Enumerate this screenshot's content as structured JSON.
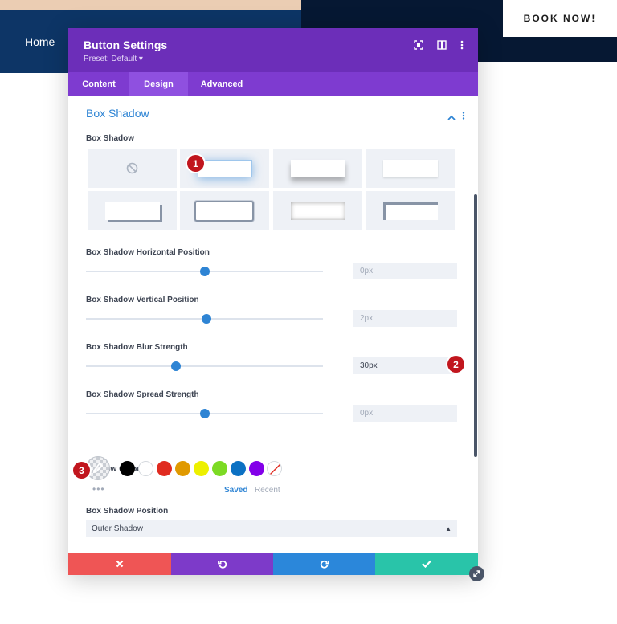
{
  "background": {
    "nav_home": "Home",
    "book_button": "BOOK NOW!"
  },
  "modal": {
    "title": "Button Settings",
    "preset": "Preset: Default ▾",
    "header_icons": [
      "expand-icon",
      "sidebar-layout-icon",
      "kebab-menu-icon"
    ],
    "tabs": [
      {
        "label": "Content",
        "active": false
      },
      {
        "label": "Design",
        "active": true
      },
      {
        "label": "Advanced",
        "active": false
      }
    ]
  },
  "section": {
    "title": "Box Shadow",
    "presets_label": "Box Shadow",
    "preset_count": 8,
    "selected_preset": 2,
    "fields": [
      {
        "label": "Box Shadow Horizontal Position",
        "value": "0px",
        "slider_fraction": 0.5
      },
      {
        "label": "Box Shadow Vertical Position",
        "value": "2px",
        "slider_fraction": 0.51
      },
      {
        "label": "Box Shadow Blur Strength",
        "value": "30px",
        "slider_fraction": 0.38
      },
      {
        "label": "Box Shadow Spread Strength",
        "value": "0px",
        "slider_fraction": 0.5
      }
    ],
    "shadow_color": {
      "label": "Shadow Color",
      "swatches": [
        "#000000",
        "#ffffff",
        "#e02b20",
        "#e09900",
        "#edf000",
        "#7cda24",
        "#0c71c3",
        "#8300e9"
      ],
      "more": "•••",
      "tab_saved": "Saved",
      "tab_recent": "Recent"
    },
    "position": {
      "label": "Box Shadow Position",
      "value": "Outer Shadow"
    }
  },
  "footer": {
    "buttons": [
      {
        "name": "cancel",
        "color": "#ef5555"
      },
      {
        "name": "undo",
        "color": "#7d3ac9"
      },
      {
        "name": "redo",
        "color": "#2b87da"
      },
      {
        "name": "save",
        "color": "#29c4a9"
      }
    ]
  },
  "annotations": [
    "1",
    "2",
    "3"
  ],
  "colors": {
    "header": "#6c2eb9",
    "tabs": "#7e3bd0",
    "accent": "#2e84d4",
    "badge": "#c1161e"
  }
}
